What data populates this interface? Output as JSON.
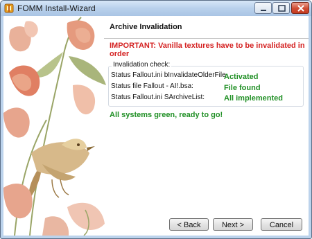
{
  "window": {
    "title": "FOMM Install-Wizard"
  },
  "page": {
    "heading": "Archive Invalidation",
    "important": "IMPORTANT: Vanilla textures have to be invalidated in order"
  },
  "check": {
    "title": "Invalidation check:",
    "rows": [
      {
        "label": "Status Fallout.ini bInvalidateOlderFile",
        "value": "Activated"
      },
      {
        "label": "Status file Fallout - AI!.bsa:",
        "value": "File found"
      },
      {
        "label": "Status Fallout.ini SArchiveList:",
        "value": "All implemented"
      }
    ]
  },
  "summary": "All systems green, ready to go!",
  "buttons": {
    "back": "< Back",
    "next": "Next >",
    "cancel": "Cancel"
  },
  "colors": {
    "important": "#d42121",
    "status_ok": "#1f8f24"
  },
  "icons": {
    "app": "fomm-app-icon",
    "minimize": "minimize-icon",
    "maximize": "maximize-icon",
    "close": "close-icon",
    "decoration": "flowers-and-bird-illustration"
  }
}
